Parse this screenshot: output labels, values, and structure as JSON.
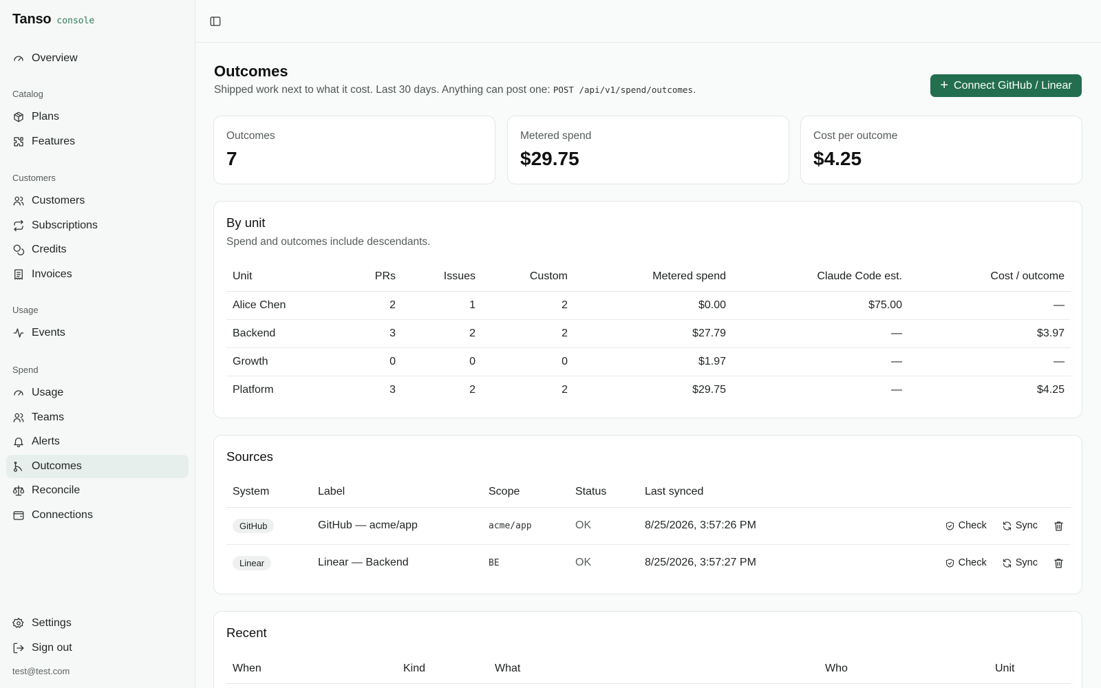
{
  "brand": {
    "name": "Tanso",
    "tag": "console"
  },
  "nav": {
    "overview": "Overview",
    "catalog_title": "Catalog",
    "plans": "Plans",
    "features": "Features",
    "customers_title": "Customers",
    "customers": "Customers",
    "subscriptions": "Subscriptions",
    "credits": "Credits",
    "invoices": "Invoices",
    "usage_title": "Usage",
    "events": "Events",
    "spend_title": "Spend",
    "usage": "Usage",
    "teams": "Teams",
    "alerts": "Alerts",
    "outcomes": "Outcomes",
    "reconcile": "Reconcile",
    "connections": "Connections",
    "settings": "Settings",
    "sign_out": "Sign out",
    "user_email": "test@test.com"
  },
  "header": {
    "title": "Outcomes",
    "subtitle": "Shipped work next to what it cost. Last 30 days. Anything can post one:",
    "endpoint": "POST /api/v1/spend/outcomes",
    "subtitle_end": ".",
    "connect_label": "Connect GitHub / Linear"
  },
  "stats": [
    {
      "label": "Outcomes",
      "value": "7"
    },
    {
      "label": "Metered spend",
      "value": "$29.75"
    },
    {
      "label": "Cost per outcome",
      "value": "$4.25"
    }
  ],
  "by_unit": {
    "title": "By unit",
    "subtitle": "Spend and outcomes include descendants.",
    "columns": [
      "Unit",
      "PRs",
      "Issues",
      "Custom",
      "Metered spend",
      "Claude Code est.",
      "Cost / outcome"
    ],
    "rows": [
      [
        "Alice Chen",
        "2",
        "1",
        "2",
        "$0.00",
        "$75.00",
        "—"
      ],
      [
        "Backend",
        "3",
        "2",
        "2",
        "$27.79",
        "—",
        "$3.97"
      ],
      [
        "Growth",
        "0",
        "0",
        "0",
        "$1.97",
        "—",
        "—"
      ],
      [
        "Platform",
        "3",
        "2",
        "2",
        "$29.75",
        "—",
        "$4.25"
      ]
    ]
  },
  "sources": {
    "title": "Sources",
    "columns": [
      "System",
      "Label",
      "Scope",
      "Status",
      "Last synced"
    ],
    "check_label": "Check",
    "sync_label": "Sync",
    "rows": [
      {
        "system": "GitHub",
        "label": "GitHub — acme/app",
        "scope": "acme/app",
        "status": "OK",
        "last_synced": "8/25/2026, 3:57:26 PM"
      },
      {
        "system": "Linear",
        "label": "Linear — Backend",
        "scope": "BE",
        "status": "OK",
        "last_synced": "8/25/2026, 3:57:27 PM"
      }
    ]
  },
  "recent": {
    "title": "Recent",
    "columns": [
      "When",
      "Kind",
      "What",
      "Who",
      "Unit"
    ]
  },
  "colors": {
    "accent": "#236e4f",
    "active_bg": "#e6efeb",
    "brand_tag": "#2f7a58"
  }
}
